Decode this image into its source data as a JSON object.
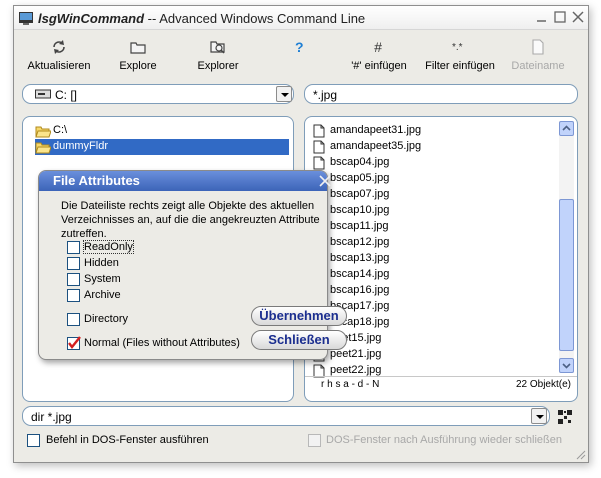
{
  "window": {
    "title_app": "lsgWinCommand",
    "title_rest": " -- Advanced Windows Command Line"
  },
  "toolbar": {
    "refresh": "Aktualisieren",
    "explore": "Explore",
    "explorer": "Explorer",
    "help": "",
    "hash_insert": "'#' einfügen",
    "filter_insert": "Filter einfügen",
    "filename": "Dateiname"
  },
  "drive_combo": {
    "value": "C: []"
  },
  "filter_combo": {
    "value": "*.jpg"
  },
  "tree": {
    "items": [
      {
        "label": "C:\\"
      },
      {
        "label": "dummyFldr"
      }
    ]
  },
  "files": [
    "amandapeet31.jpg",
    "amandapeet35.jpg",
    "bscap04.jpg",
    "bscap05.jpg",
    "bscap07.jpg",
    "bscap10.jpg",
    "bscap11.jpg",
    "bscap12.jpg",
    "bscap13.jpg",
    "bscap14.jpg",
    "bscap16.jpg",
    "bscap17.jpg",
    "bscap18.jpg",
    "peet15.jpg",
    "peet21.jpg",
    "peet22.jpg"
  ],
  "file_status": {
    "attrs": "r h s a - d - N",
    "count": "22 Objekt(e)"
  },
  "command": {
    "value": "dir *.jpg"
  },
  "footer": {
    "dos_window": "Befehl in DOS-Fenster ausführen",
    "close_after": "DOS-Fenster nach Ausführung wieder schließen"
  },
  "dialog": {
    "title": "File Attributes",
    "description": "Die Dateiliste rechts zeigt alle Objekte des aktuellen Verzeichnisses an, auf die die angekreuzten Attribute zutreffen.",
    "options": {
      "readonly": "ReadOnly",
      "hidden": "Hidden",
      "system": "System",
      "archive": "Archive",
      "directory": "Directory",
      "normal": "Normal (Files without Attributes)"
    },
    "apply": "Übernehmen",
    "close": "Schließen"
  },
  "colors": {
    "selection": "#316ac5",
    "dialog_title": "#3c64b8",
    "button_text": "#1b2e8f",
    "check_red": "#d42020"
  }
}
